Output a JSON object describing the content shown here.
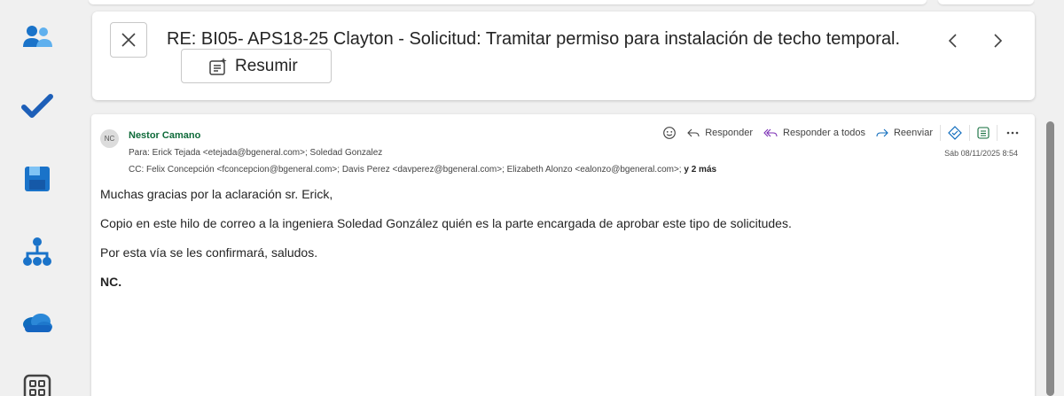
{
  "rail": {
    "items": [
      {
        "name": "people-icon"
      },
      {
        "name": "todo-icon"
      },
      {
        "name": "save-icon"
      },
      {
        "name": "org-icon"
      },
      {
        "name": "onedrive-icon"
      },
      {
        "name": "apps-icon"
      }
    ]
  },
  "subject": {
    "text": "RE: BI05- APS18-25 Clayton - Solicitud: Tramitar permiso para instalación de techo temporal.",
    "summarize_label": "Resumir"
  },
  "message": {
    "avatar_initials": "NC",
    "sender": "Nestor Camano",
    "to": "Para: Erick Tejada <etejada@bgeneral.com>;  Soledad Gonzalez",
    "cc": "CC: Felix Concepción <fconcepcion@bgeneral.com>;  Davis Perez <davperez@bgeneral.com>;  Elizabeth Alonzo <ealonzo@bgeneral.com>;",
    "cc_more": "y 2 más",
    "date": "Sáb 08/11/2025 8:54",
    "actions": {
      "reply": "Responder",
      "reply_all": "Responder a todos",
      "forward": "Reenviar"
    },
    "body": [
      "Muchas gracias por la aclaración sr. Erick,",
      "Copio en este hilo de correo a la ingeniera Soledad González quién es la parte encargada de aprobar este tipo de solicitudes.",
      "Por esta vía se les confirmará, saludos.",
      "NC."
    ]
  },
  "colors": {
    "accent": "#0f6cbd",
    "sender": "#0f6b3a",
    "background": "#f0f0f0"
  }
}
